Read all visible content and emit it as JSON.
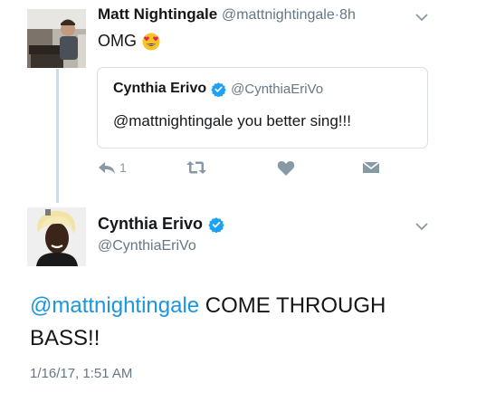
{
  "tweet1": {
    "display_name": "Matt Nightingale",
    "handle": "@mattnightingale",
    "separator": "·",
    "time": "8h",
    "text": "OMG",
    "emoji": "heart-eyes-emoji",
    "quote": {
      "display_name": "Cynthia Erivo",
      "handle": "@CynthiaEriVo",
      "text": "@mattnightingale you better sing!!!"
    },
    "actions": {
      "reply_count": "1"
    }
  },
  "tweet2": {
    "display_name": "Cynthia Erivo",
    "handle": "@CynthiaEriVo",
    "mention": "@mattnightingale",
    "text_rest": " COME THROUGH BASS!!",
    "timestamp": "1/16/17, 1:51 AM"
  },
  "colors": {
    "link": "#1b95e0",
    "verified": "#1da1f2",
    "muted": "#657786",
    "icon": "#8899a6",
    "thread_line": "#d3dbe2"
  },
  "icons": [
    "chevron-down-icon",
    "verified-badge-icon",
    "reply-icon",
    "retweet-icon",
    "heart-icon",
    "envelope-icon"
  ]
}
